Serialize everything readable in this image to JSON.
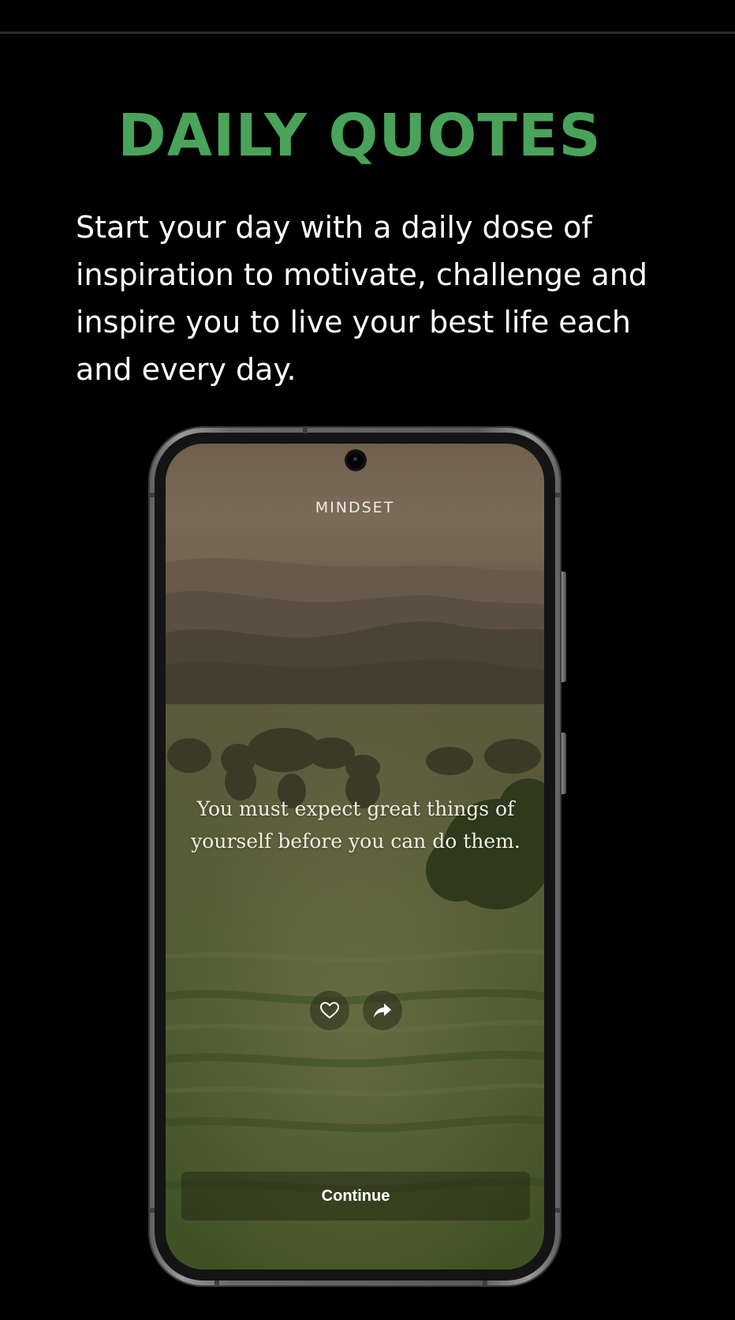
{
  "headline": "DAILY QUOTES",
  "intro": "Start your day with a daily dose of inspiration to motivate, challenge and inspire you to live your best life each and every day.",
  "phone": {
    "app_name": "MINDSET",
    "quote": "You must expect great things of yourself before you can do them.",
    "continue_label": "Continue",
    "icons": {
      "like": "heart-icon",
      "share": "share-arrow-icon"
    }
  },
  "colors": {
    "background": "#000000",
    "headline": "#4aa35a",
    "body_text": "#ffffff"
  }
}
